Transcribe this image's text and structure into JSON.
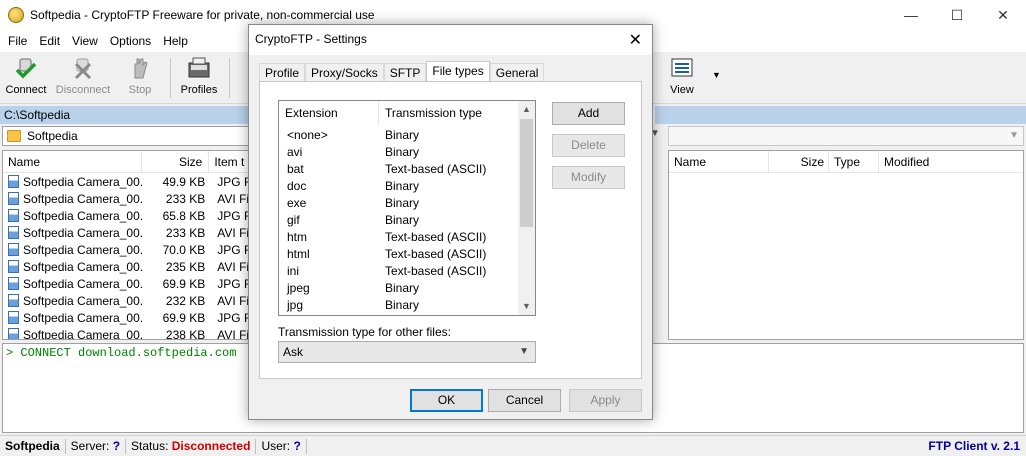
{
  "window": {
    "title": "Softpedia - CryptoFTP  Freeware for private, non-commercial use",
    "minimize": "—",
    "maximize": "☐",
    "close": "✕"
  },
  "menu": [
    "File",
    "Edit",
    "View",
    "Options",
    "Help"
  ],
  "toolbar": {
    "connect": "Connect",
    "disconnect": "Disconnect",
    "stop": "Stop",
    "profiles": "Profiles",
    "view": "View"
  },
  "left_pane": {
    "path": "C:\\Softpedia",
    "folder": "Softpedia",
    "columns": [
      "Name",
      "Size",
      "Item t"
    ],
    "files": [
      {
        "name": "Softpedia Camera_00...",
        "size": "49.9 KB",
        "type": "JPG Fi"
      },
      {
        "name": "Softpedia Camera_00...",
        "size": "233 KB",
        "type": "AVI Fil"
      },
      {
        "name": "Softpedia Camera_00...",
        "size": "65.8 KB",
        "type": "JPG Fi"
      },
      {
        "name": "Softpedia Camera_00...",
        "size": "233 KB",
        "type": "AVI Fil"
      },
      {
        "name": "Softpedia Camera_00...",
        "size": "70.0 KB",
        "type": "JPG Fi"
      },
      {
        "name": "Softpedia Camera_00...",
        "size": "235 KB",
        "type": "AVI Fil"
      },
      {
        "name": "Softpedia Camera_00...",
        "size": "69.9 KB",
        "type": "JPG Fi"
      },
      {
        "name": "Softpedia Camera_00...",
        "size": "232 KB",
        "type": "AVI Fil"
      },
      {
        "name": "Softpedia Camera_00...",
        "size": "69.9 KB",
        "type": "JPG Fi"
      },
      {
        "name": "Softpedia Camera_00...",
        "size": "238 KB",
        "type": "AVI Fil"
      }
    ]
  },
  "right_pane": {
    "columns": [
      "Name",
      "Size",
      "Type",
      "Modified"
    ]
  },
  "log": {
    "line": "> CONNECT download.softpedia.com"
  },
  "status": {
    "name": "Softpedia",
    "server_label": "Server:",
    "server_value": "?",
    "status_label": "Status:",
    "status_value": "Disconnected",
    "user_label": "User:",
    "user_value": "?",
    "version": "FTP Client v. 2.1"
  },
  "dialog": {
    "title": "CryptoFTP - Settings",
    "close": "✕",
    "tabs": [
      "Profile",
      "Proxy/Socks",
      "SFTP",
      "File types",
      "General"
    ],
    "active_tab": "File types",
    "list_headers": [
      "Extension",
      "Transmission type"
    ],
    "file_types": [
      {
        "ext": "<none>",
        "type": "Binary"
      },
      {
        "ext": "avi",
        "type": "Binary"
      },
      {
        "ext": "bat",
        "type": "Text-based (ASCII)"
      },
      {
        "ext": "doc",
        "type": "Binary"
      },
      {
        "ext": "exe",
        "type": "Binary"
      },
      {
        "ext": "gif",
        "type": "Binary"
      },
      {
        "ext": "htm",
        "type": "Text-based (ASCII)"
      },
      {
        "ext": "html",
        "type": "Text-based (ASCII)"
      },
      {
        "ext": "ini",
        "type": "Text-based (ASCII)"
      },
      {
        "ext": "jpeg",
        "type": "Binary"
      },
      {
        "ext": "jpg",
        "type": "Binary"
      }
    ],
    "add": "Add",
    "delete": "Delete",
    "modify": "Modify",
    "other_label": "Transmission type for other files:",
    "other_value": "Ask",
    "ok": "OK",
    "cancel": "Cancel",
    "apply": "Apply"
  },
  "colors": {
    "path_bar": "#b9d1ea",
    "status_red": "#d00000",
    "status_blue": "#0000a0",
    "log_green": "#008000",
    "accent": "#0078d7"
  }
}
